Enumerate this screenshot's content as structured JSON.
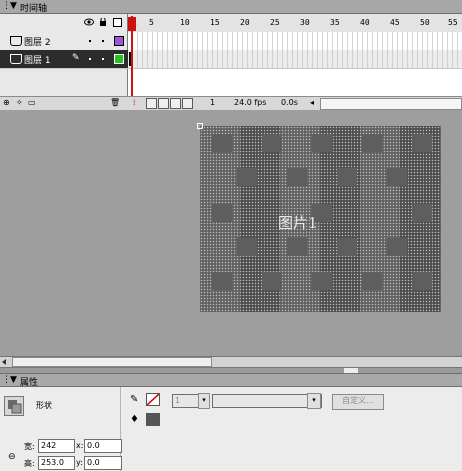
{
  "timeline": {
    "title": "时间轴",
    "ruler": [
      "1",
      "5",
      "10",
      "15",
      "20",
      "25",
      "30",
      "35",
      "40",
      "45",
      "50",
      "55"
    ],
    "layers": [
      {
        "name": "图层 2",
        "selected": false
      },
      {
        "name": "图层 1",
        "selected": true
      }
    ],
    "footer": {
      "frame": "1",
      "fps": "24.0 fps",
      "time": "0.0s"
    }
  },
  "stage": {
    "image_label": "图片1"
  },
  "properties": {
    "title": "属性",
    "type_label": "形状",
    "stroke_height": "1",
    "custom_button": "自定义...",
    "w_label": "宽:",
    "w_value": "242",
    "h_label": "高:",
    "h_value": "253.0",
    "x_label": "x:",
    "x_value": "0.0",
    "y_label": "y:",
    "y_value": "0.0"
  },
  "colors": {
    "playhead": "#cc1111",
    "accent": "#0000ff"
  }
}
